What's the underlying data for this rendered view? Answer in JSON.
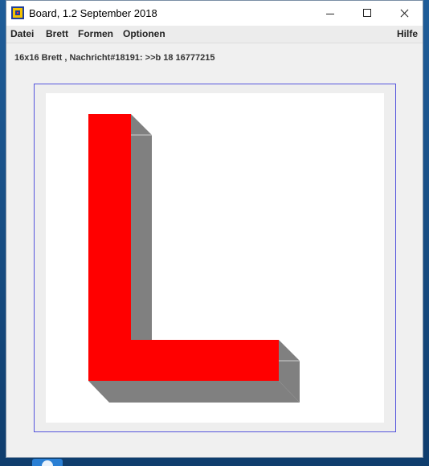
{
  "window": {
    "title": "Board, 1.2 September 2018"
  },
  "menu": {
    "datei": "Datei",
    "brett": "Brett",
    "formen": "Formen",
    "optionen": "Optionen",
    "hilfe": "Hilfe"
  },
  "status": {
    "text": "16x16 Brett , Nachricht#18191: >>b 18 16777215"
  },
  "board": {
    "shape": "L",
    "shape_color": "#ff0000",
    "shadow_color": "#808080",
    "background": "#ffffff",
    "frame_color": "#5555dd"
  }
}
